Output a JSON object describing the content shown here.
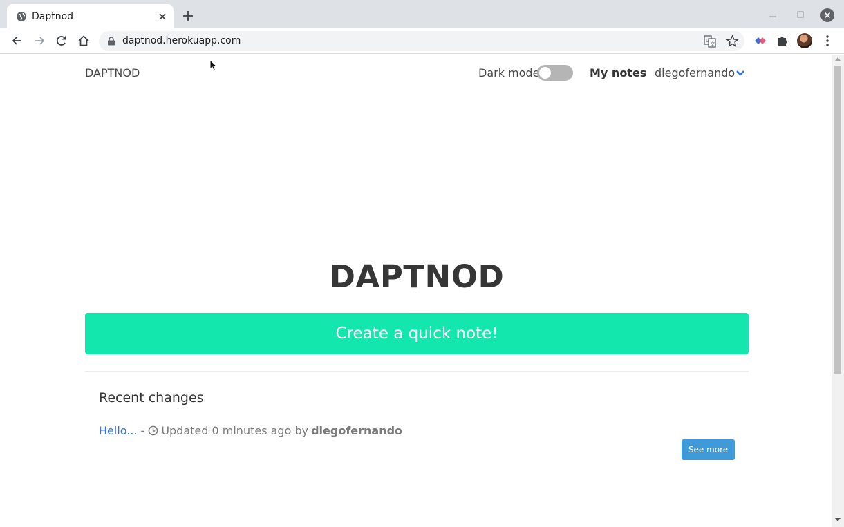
{
  "browser": {
    "tab_title": "Daptnod",
    "url": "daptnod.herokuapp.com",
    "icons": [
      "globe-icon",
      "close-icon",
      "plus-icon",
      "back-icon",
      "forward-icon",
      "reload-icon",
      "home-icon",
      "lock-icon",
      "translate-icon",
      "star-icon",
      "extension-icon",
      "puzzle-icon",
      "avatar",
      "menu-icon",
      "minimize-icon",
      "maximize-icon",
      "window-close-icon"
    ]
  },
  "navbar": {
    "brand": "DAPTNOD",
    "dark_mode_label": "Dark mode",
    "dark_mode_on": false,
    "my_notes": "My notes",
    "username": "diegofernando"
  },
  "hero": {
    "title": "DAPTNOD",
    "quick_note_button": "Create a quick note!"
  },
  "recent": {
    "title": "Recent changes",
    "items": [
      {
        "note": "Hello...",
        "separator": "-",
        "text": "Updated 0 minutes ago by",
        "author": "diegofernando"
      }
    ],
    "see_more": "See more"
  },
  "colors": {
    "accent_green": "#13e7ad",
    "link_blue": "#3273dc",
    "button_blue": "#3e9ad8"
  }
}
